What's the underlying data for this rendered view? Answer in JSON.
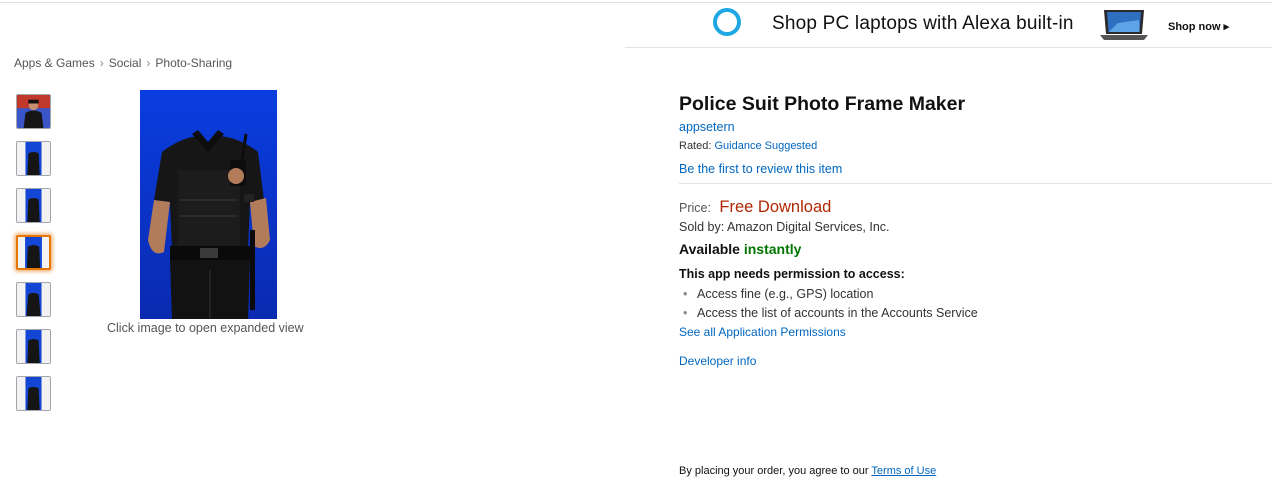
{
  "ad": {
    "text": "Shop PC laptops with Alexa built-in",
    "cta": "Shop now ▸",
    "icon": "alexa-ring-icon",
    "ring_color": "#1ea7e3"
  },
  "breadcrumb": [
    {
      "label": "Apps & Games"
    },
    {
      "label": "Social"
    },
    {
      "label": "Photo-Sharing"
    }
  ],
  "breadcrumb_separator": "›",
  "gallery": {
    "thumbnail_count": 7,
    "selected_thumbnail": 4,
    "zoom_hint": "Click image to open expanded view"
  },
  "product": {
    "title": "Police Suit Photo Frame Maker",
    "developer": "appsetern",
    "rated_label": "Rated:",
    "rating": "Guidance Suggested",
    "review_link": "Be the first to review this item",
    "price_label": "Price:",
    "price_value": "Free Download",
    "sold_by": "Sold by: Amazon Digital Services, Inc.",
    "available_label": "Available",
    "available_value": "instantly",
    "permissions_heading": "This app needs permission to access:",
    "permissions": [
      "Access fine (e.g., GPS) location",
      "Access the list of accounts in the Accounts Service"
    ],
    "see_all_permissions": "See all Application Permissions",
    "developer_info": "Developer info"
  },
  "terms": {
    "text": "By placing your order, you agree to our",
    "link": "Terms of Use"
  },
  "colors": {
    "link": "#0066c0",
    "price": "#b12704",
    "available": "#007600",
    "selected_border": "#e77600",
    "photo_background": "#0a3de0"
  }
}
